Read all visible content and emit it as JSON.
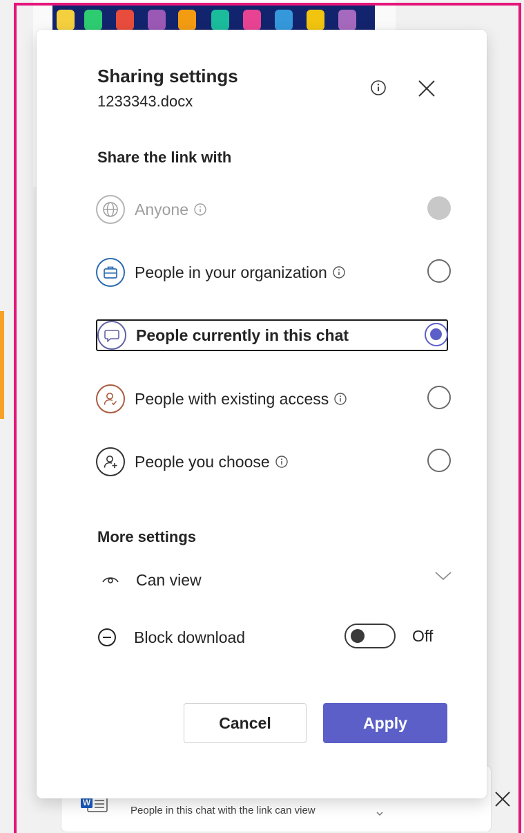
{
  "dialog": {
    "title": "Sharing settings",
    "filename": "1233343.docx"
  },
  "share_section": {
    "heading": "Share the link with",
    "options": [
      {
        "label": "Anyone",
        "icon": "globe-icon",
        "info": true,
        "state": "disabled"
      },
      {
        "label": "People in your organization",
        "icon": "briefcase-icon",
        "info": true,
        "state": "unselected"
      },
      {
        "label": "People currently in this chat",
        "icon": "chat-icon",
        "info": false,
        "state": "selected"
      },
      {
        "label": "People with existing access",
        "icon": "person-check-icon",
        "info": true,
        "state": "unselected"
      },
      {
        "label": "People you choose",
        "icon": "person-add-icon",
        "info": true,
        "state": "unselected"
      }
    ]
  },
  "more_settings": {
    "heading": "More settings",
    "permission": {
      "label": "Can view",
      "icon": "eye-icon"
    },
    "block_download": {
      "label": "Block download",
      "toggle_state": "Off"
    }
  },
  "buttons": {
    "cancel": "Cancel",
    "apply": "Apply"
  },
  "background": {
    "link_summary": "People in this chat with the link can view"
  },
  "colors": {
    "accent": "#5b5fc7",
    "frame": "#e5157a",
    "disabled": "#9e9e9e"
  }
}
